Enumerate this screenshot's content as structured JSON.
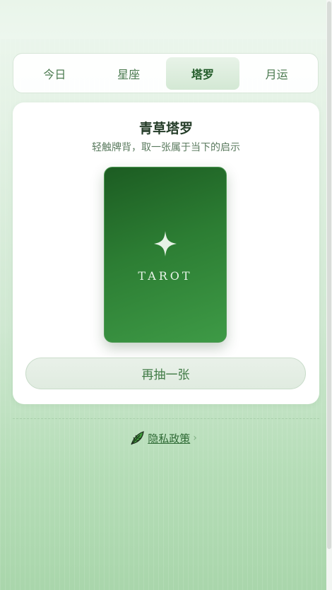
{
  "tabs": [
    {
      "label": "今日"
    },
    {
      "label": "星座"
    },
    {
      "label": "塔罗",
      "active": true
    },
    {
      "label": "月运"
    }
  ],
  "card": {
    "title": "青草塔罗",
    "subtitle": "轻触牌背，取一张属于当下的启示",
    "tarot_back_text": "TAROT",
    "redraw_label": "再抽一张"
  },
  "footer": {
    "privacy_label": "隐私政策",
    "chevron": "›"
  },
  "icons": {
    "sparkle": "four-point-star-icon",
    "leaf": "leaf-icon"
  },
  "colors": {
    "accent": "#2c7d33",
    "text_primary": "#243c28",
    "text_secondary": "#5a7a5e"
  }
}
